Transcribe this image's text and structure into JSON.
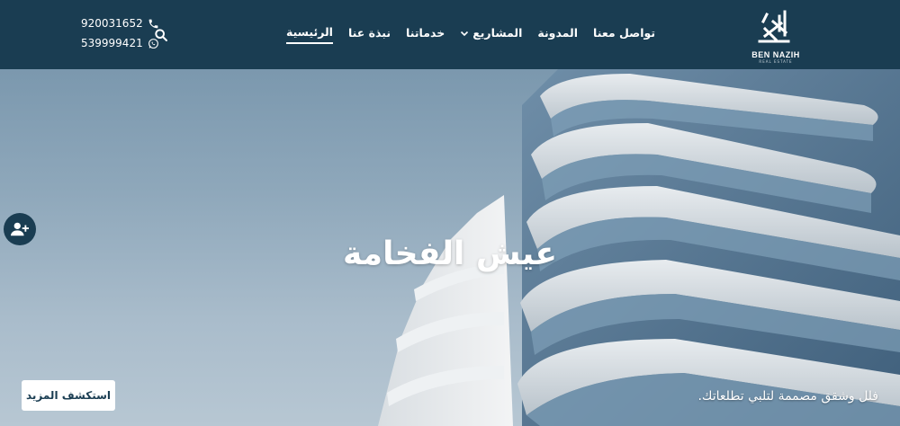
{
  "header": {
    "phone": "920031652",
    "whatsapp": "539999421",
    "nav": [
      {
        "label": "الرئيسية",
        "active": true
      },
      {
        "label": "نبذة عنا",
        "active": false
      },
      {
        "label": "خدماتنا",
        "active": false
      },
      {
        "label": "المشاريع",
        "active": false,
        "has_dropdown": true
      },
      {
        "label": "المدونة",
        "active": false
      },
      {
        "label": "تواصل معنا",
        "active": false
      }
    ],
    "logo": {
      "name": "BEN NAZIH",
      "tagline": "REAL ESTATE"
    }
  },
  "hero": {
    "title": "عيش الفخامة",
    "subtitle": "فلل وشقق مصممة لتلبي تطلعاتك.",
    "cta_label": "استكشف المزيد"
  },
  "colors": {
    "primary": "#1a3d52",
    "white": "#ffffff"
  },
  "icons": [
    "phone-icon",
    "whatsapp-icon",
    "search-icon",
    "chevron-down-icon",
    "user-plus-icon"
  ]
}
